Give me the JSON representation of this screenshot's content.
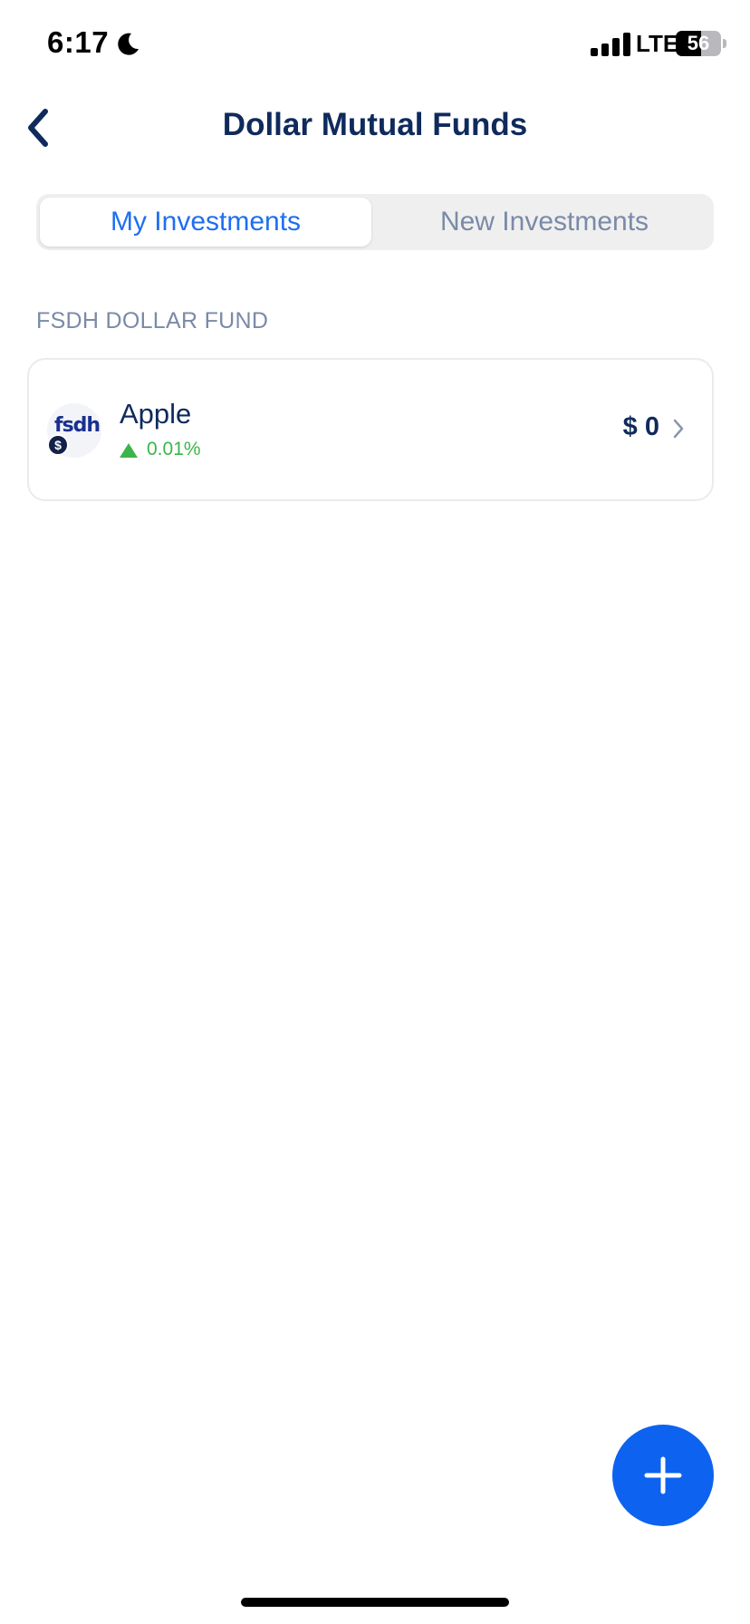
{
  "status_bar": {
    "time": "6:17",
    "network": "LTE",
    "battery_level": "56",
    "battery_fraction": 0.56
  },
  "header": {
    "title": "Dollar Mutual Funds",
    "back_icon": "chevron-left-icon"
  },
  "tabs": [
    {
      "label": "My Investments",
      "active": true
    },
    {
      "label": "New Investments",
      "active": false
    }
  ],
  "section": {
    "label": "FSDH DOLLAR FUND"
  },
  "fund": {
    "logo_text": "fsdh",
    "badge_symbol": "$",
    "name": "Apple",
    "change": "0.01%",
    "trend": "up",
    "value": "$ 0"
  },
  "fab": {
    "icon": "plus-icon"
  },
  "colors": {
    "primary": "#0d63ef",
    "title": "#0f2a5c",
    "muted": "#7a8aa8",
    "positive": "#3bb54a"
  }
}
